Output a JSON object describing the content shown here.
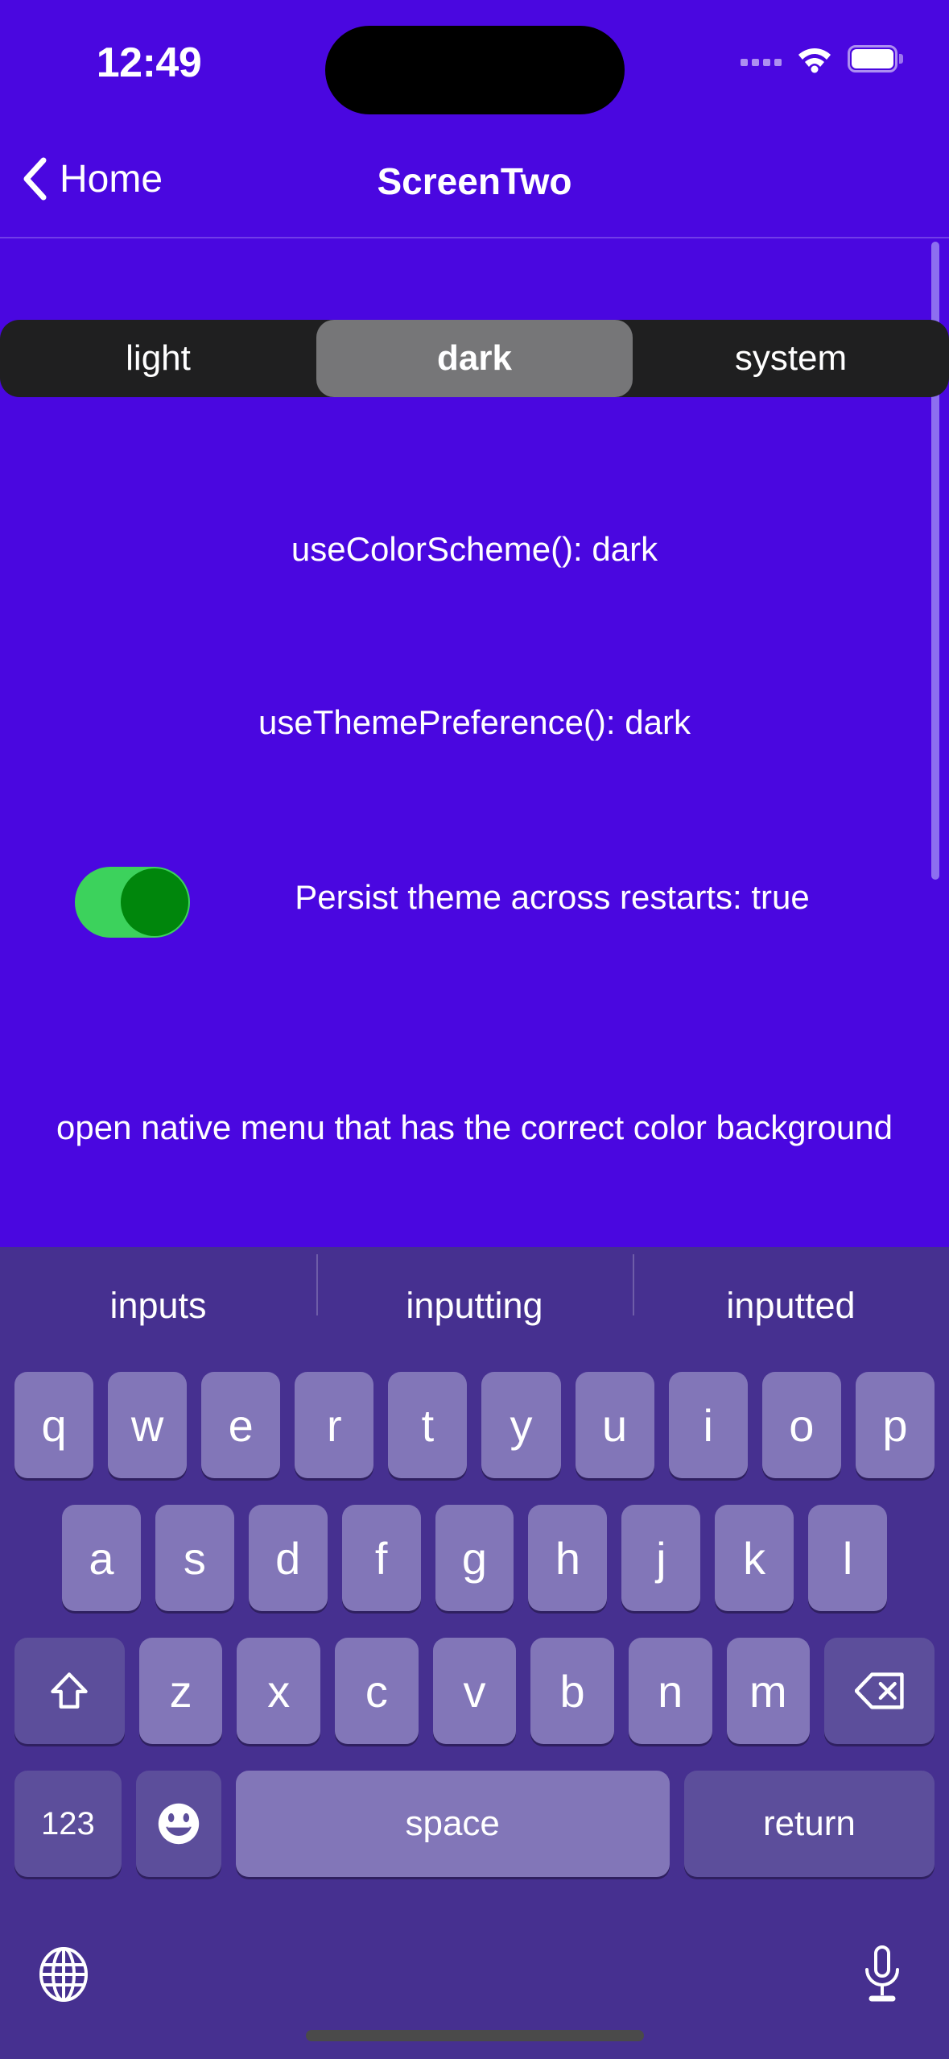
{
  "theme": {
    "background": "#4A07E0",
    "keyboard_bg": "#463090",
    "key_bg": "#8276B8",
    "key_dark_bg": "#5C4E9B",
    "segment_track": "#1F1F20",
    "segment_selected": "#767678",
    "toggle_track": "#3CD25C",
    "toggle_knob": "#00860C",
    "scroll_indicator": "#8D6FF0",
    "home_indicator": "#4A4A4A"
  },
  "status_bar": {
    "time": "12:49",
    "icons": [
      "cellular-signal-icon",
      "wifi-icon",
      "battery-icon"
    ]
  },
  "nav_bar": {
    "back_label": "Home",
    "back_icon": "chevron-left-icon",
    "title": "ScreenTwo"
  },
  "segmented_control": {
    "selected": "dark",
    "options": [
      {
        "label": "light",
        "selected": false
      },
      {
        "label": "dark",
        "selected": true
      },
      {
        "label": "system",
        "selected": false
      }
    ]
  },
  "content": {
    "color_scheme_line": "useColorScheme(): dark",
    "theme_preference_line": "useThemePreference(): dark",
    "persist_label": "Persist theme across restarts: true",
    "persist_value": "true",
    "native_menu_text": "open native menu that has the correct color background"
  },
  "keyboard": {
    "predictions": [
      "inputs",
      "inputting",
      "inputted"
    ],
    "row1": [
      "q",
      "w",
      "e",
      "r",
      "t",
      "y",
      "u",
      "i",
      "o",
      "p"
    ],
    "row2": [
      "a",
      "s",
      "d",
      "f",
      "g",
      "h",
      "j",
      "k",
      "l"
    ],
    "row3_letters": [
      "z",
      "x",
      "c",
      "v",
      "b",
      "n",
      "m"
    ],
    "shift_key": "shift-icon",
    "backspace_key": "backspace-icon",
    "numeric_key": "123",
    "emoji_key": "emoji-icon",
    "space_key": "space",
    "return_key": "return",
    "globe_key": "globe-icon",
    "dictation_key": "microphone-icon"
  }
}
